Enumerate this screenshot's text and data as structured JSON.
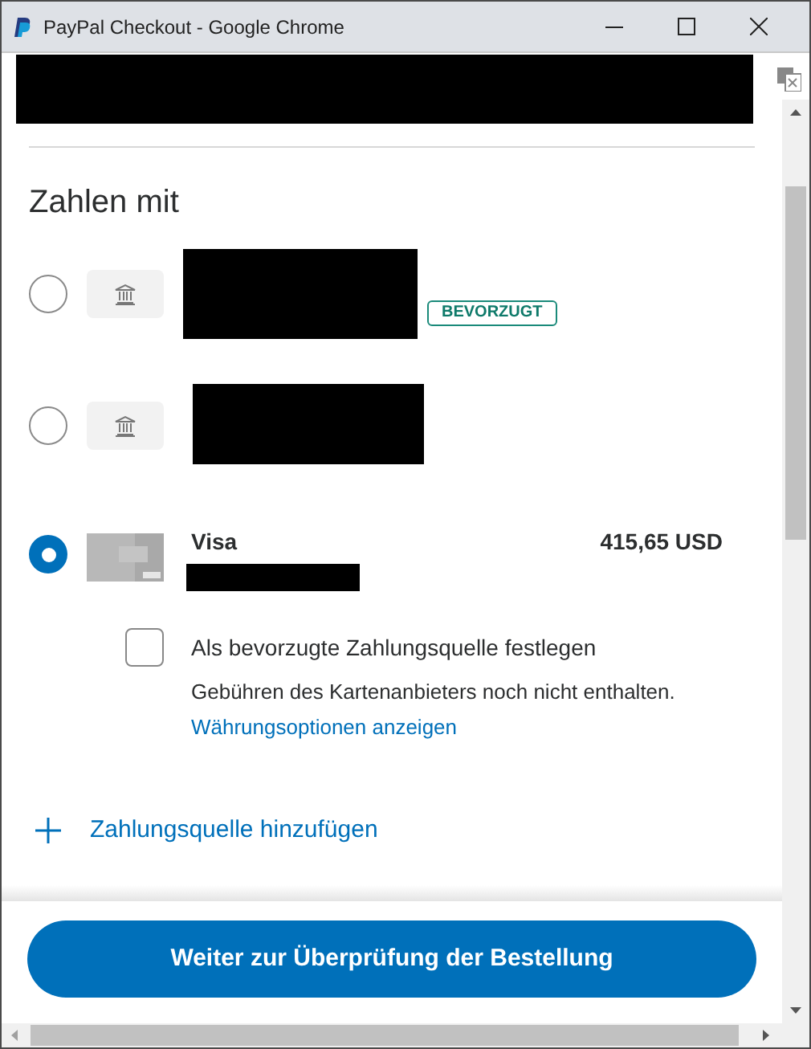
{
  "window": {
    "title": "PayPal Checkout - Google Chrome"
  },
  "section_title": "Zahlen mit",
  "payment_methods": [
    {
      "kind": "bank",
      "selected": false,
      "badge": "BEVORZUGT"
    },
    {
      "kind": "bank",
      "selected": false
    },
    {
      "kind": "card",
      "selected": true,
      "name": "Visa",
      "amount": "415,65 USD",
      "preferred_option": {
        "label": "Als bevorzugte Zahlungsquelle festlegen",
        "checked": false
      },
      "note": "Gebühren des Kartenanbieters noch nicht enthalten.",
      "link": "Währungsoptionen anzeigen"
    }
  ],
  "add_source": "Zahlungsquelle hinzufügen",
  "continue_button": "Weiter zur Überprüfung der Bestellung"
}
